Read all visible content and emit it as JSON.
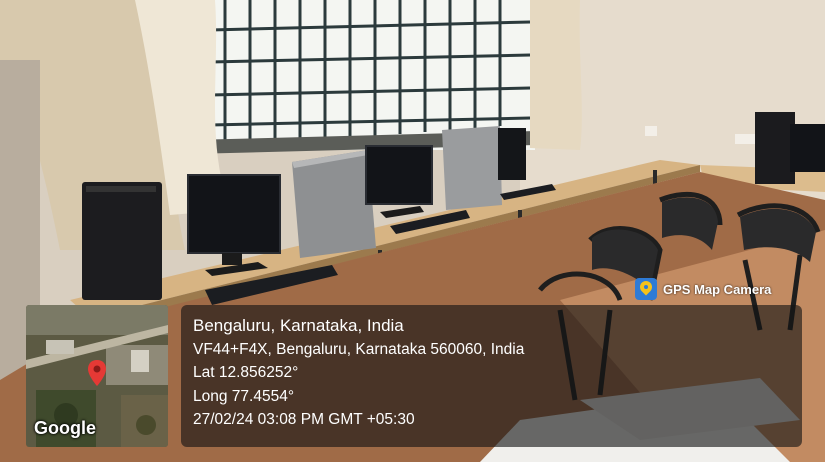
{
  "photo": {
    "description_icon": "computer-lab-photo"
  },
  "badge": {
    "title": "GPS Map Camera",
    "icon": "gps-map-camera-logo"
  },
  "location": {
    "place": "Bengaluru, Karnataka, India",
    "address": "VF44+F4X, Bengaluru, Karnataka 560060, India",
    "lat": "Lat 12.856252°",
    "long": "Long 77.4554°",
    "datetime": "27/02/24 03:08 PM GMT +05:30"
  },
  "map": {
    "brand": "Google",
    "pin_color": "#e53935"
  }
}
